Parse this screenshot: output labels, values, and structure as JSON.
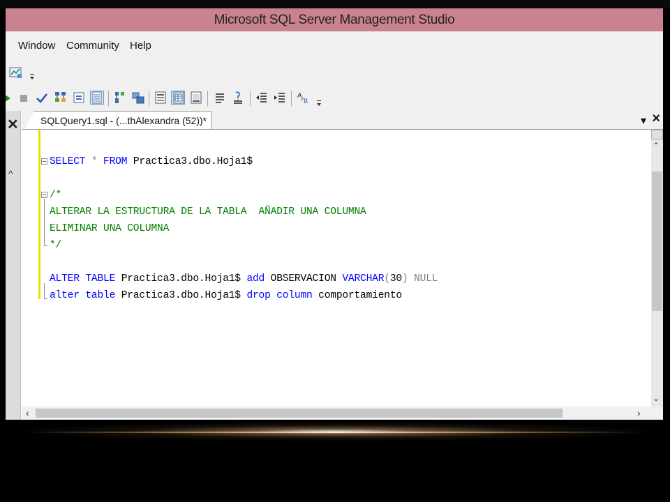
{
  "app": {
    "title": "Microsoft SQL Server Management Studio"
  },
  "menu": [
    "Window",
    "Community",
    "Help"
  ],
  "toolbar1": {
    "icons": [
      "chart-icon"
    ]
  },
  "toolbar2": {
    "icons": [
      "execute-arrow-icon",
      "stop-icon",
      "parse-check-icon",
      "display-plan-icon",
      "results-to-text-icon",
      "results-to-grid-icon",
      "query-options-icon",
      "include-client-stats-icon",
      "results-to-file-icon",
      "save-results-icon",
      "comment-icon",
      "uncomment-icon",
      "decrease-indent-icon",
      "increase-indent-icon",
      "specify-values-icon"
    ]
  },
  "document": {
    "tab_label": "SQLQuery1.sql - (...thAlexandra (52))*",
    "tab_controls": {
      "dropdown": "▾",
      "close": "×"
    },
    "lines": [
      {
        "segments": [
          {
            "t": "SELECT",
            "c": "kw"
          },
          {
            "t": " * ",
            "c": "gr"
          },
          {
            "t": "FROM",
            "c": "kw"
          },
          {
            "t": " Practica3.dbo.Hoja1$",
            "c": ""
          }
        ]
      },
      {
        "segments": []
      },
      {
        "segments": [
          {
            "t": "/*",
            "c": "cm"
          }
        ]
      },
      {
        "segments": [
          {
            "t": "ALTERAR LA ESTRUCTURA DE LA TABLA  AÑADIR UNA COLUMNA",
            "c": "cm"
          }
        ]
      },
      {
        "segments": [
          {
            "t": "ELIMINAR UNA COLUMNA",
            "c": "cm"
          }
        ]
      },
      {
        "segments": [
          {
            "t": "*/",
            "c": "cm"
          }
        ]
      },
      {
        "segments": []
      },
      {
        "segments": [
          {
            "t": "ALTER",
            "c": "kw"
          },
          {
            "t": " ",
            "c": ""
          },
          {
            "t": "TABLE",
            "c": "kw"
          },
          {
            "t": " Practica3.dbo.Hoja1$ ",
            "c": ""
          },
          {
            "t": "add",
            "c": "kw"
          },
          {
            "t": " OBSERVACION ",
            "c": ""
          },
          {
            "t": "VARCHAR",
            "c": "kw"
          },
          {
            "t": "(",
            "c": "gr"
          },
          {
            "t": "30",
            "c": ""
          },
          {
            "t": ")",
            "c": "gr"
          },
          {
            "t": " NULL",
            "c": "gr"
          }
        ]
      },
      {
        "segments": [
          {
            "t": "alter",
            "c": "kw"
          },
          {
            "t": " ",
            "c": ""
          },
          {
            "t": "table",
            "c": "kw"
          },
          {
            "t": " Practica3.dbo.Hoja1$ ",
            "c": ""
          },
          {
            "t": "drop",
            "c": "kw"
          },
          {
            "t": " ",
            "c": ""
          },
          {
            "t": "column",
            "c": "kw"
          },
          {
            "t": " comportamiento",
            "c": ""
          }
        ]
      }
    ]
  },
  "colors": {
    "titlebar": "#c98290",
    "keyword": "#0000ff",
    "comment": "#008000",
    "operator": "#808080",
    "change_bar": "#e8e000"
  }
}
